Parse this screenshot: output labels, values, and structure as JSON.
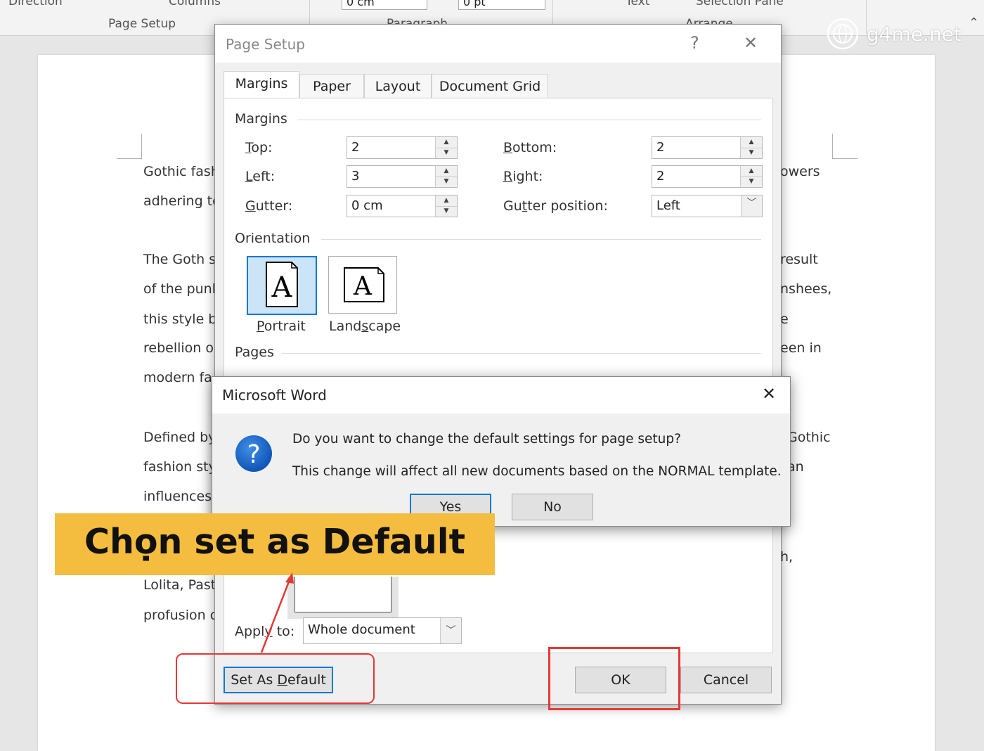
{
  "ribbon": {
    "direction_label": "Direction",
    "columns_label": "Columns",
    "page_setup_group": "Page Setup",
    "paragraph_group": "Paragraph",
    "arrange_group": "Arrange",
    "indent_value": "0 cm",
    "spacing_value": "0 pt",
    "text_label": "Text",
    "selection_pane": "Selection Pane"
  },
  "document": {
    "left_lines": [
      "Gothic fash",
      "adhering to",
      "",
      "The Goth s",
      "of the punk",
      "this style b",
      "rebellion o",
      "modern fa",
      "",
      "Defined by",
      "fashion sty",
      "influences",
      "",
      "Lolita, Past",
      "profusion c"
    ],
    "right_lines": [
      "owers",
      "result",
      "nshees,",
      "e",
      "een in",
      "Gothic",
      "an",
      "h,"
    ]
  },
  "watermark": {
    "text": "g4me.net"
  },
  "page_setup": {
    "title": "Page Setup",
    "help": "?",
    "close": "✕",
    "tabs": [
      "Margins",
      "Paper",
      "Layout",
      "Document Grid"
    ],
    "margins_section": "Margins",
    "top": {
      "before": "",
      "accel": "T",
      "after": "op:",
      "value": "2"
    },
    "left": {
      "before": "",
      "accel": "L",
      "after": "eft:",
      "value": "3"
    },
    "gutter": {
      "before": "",
      "accel": "G",
      "after": "utter:",
      "value": "0 cm"
    },
    "bottom": {
      "before": "",
      "accel": "B",
      "after": "ottom:",
      "value": "2"
    },
    "right": {
      "before": "",
      "accel": "R",
      "after": "ight:",
      "value": "2"
    },
    "gutter_position": {
      "before": "Gu",
      "accel": "t",
      "after": "ter position:",
      "value": "Left"
    },
    "orientation_section": "Orientation",
    "portrait": {
      "before": "",
      "accel": "P",
      "after": "ortrait"
    },
    "landscape": {
      "before": "Land",
      "accel": "s",
      "after": "cape"
    },
    "page_glyph": "A",
    "pages_section": "Pages",
    "apply_to": {
      "before": "Appl",
      "accel": "y",
      "after": " to:",
      "value": "Whole document"
    },
    "set_default": {
      "before": "Set As ",
      "accel": "D",
      "after": "efault"
    },
    "ok_label": "OK",
    "cancel_label": "Cancel"
  },
  "message_box": {
    "title": "Microsoft Word",
    "close": "✕",
    "icon_glyph": "?",
    "line1": "Do you want to change the default settings for page setup?",
    "line2": "This change will affect all new documents based on the NORMAL template.",
    "yes_label": "Yes",
    "no_label": "No"
  },
  "annotation": {
    "banner_text": "Chọn set as Default",
    "banner_color": "#f5bd3f",
    "highlight_color": "#e53935"
  }
}
